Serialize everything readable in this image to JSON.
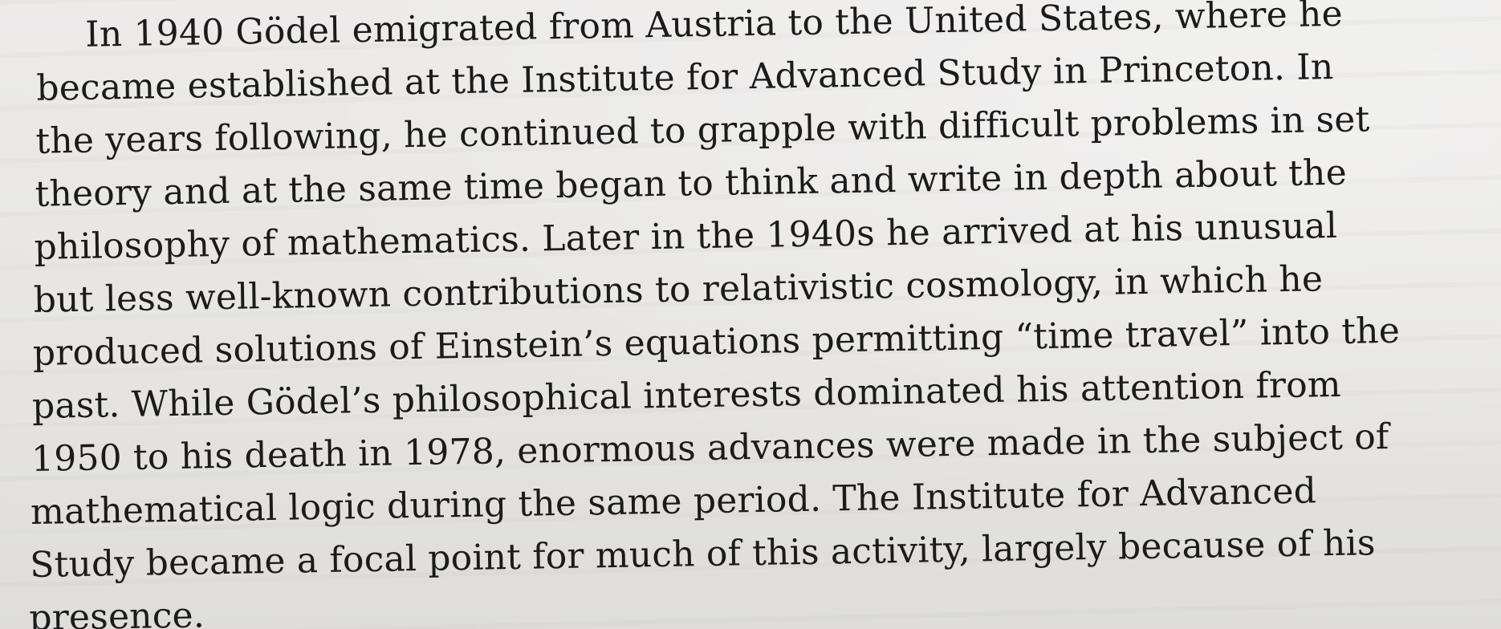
{
  "paragraph": {
    "lines": [
      "In 1940 Gödel emigrated from Austria to the United States, where he",
      "became established at the Institute for Advanced Study in Princeton. In",
      "the years following, he continued to grapple with difficult problems in set",
      "theory and at the same time began to think and write in depth about the",
      "philosophy of mathematics. Later in the 1940s he arrived at his unusual",
      "but less well-known contributions to relativistic cosmology, in which he",
      "produced solutions of Einstein’s equations permitting “time travel” into the",
      "past. While Gödel’s philosophical interests dominated his attention from",
      "1950 to his death in 1978, enormous advances were made in the subject of",
      "mathematical logic during the same period. The Institute for Advanced",
      "Study became a focal point for much of this activity, largely because of his",
      "presence."
    ]
  }
}
